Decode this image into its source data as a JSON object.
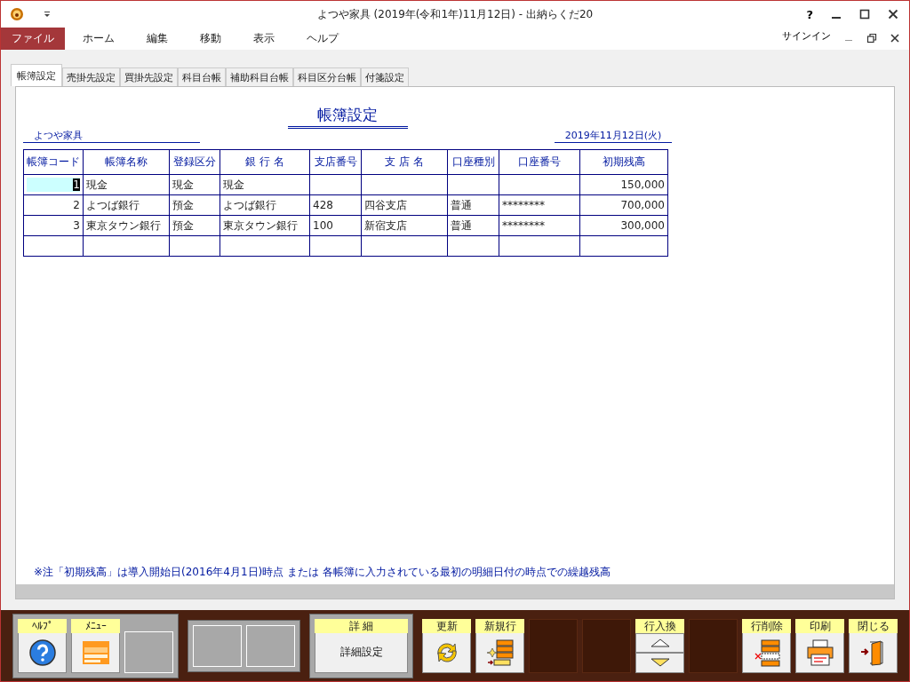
{
  "window": {
    "title": "よつや家具 (2019年(令和1年)11月12日) - 出納らくだ20",
    "help": "?"
  },
  "menu": {
    "items": [
      {
        "label": "ファイル",
        "selected": true
      },
      {
        "label": "ホーム",
        "selected": false
      },
      {
        "label": "編集",
        "selected": false
      },
      {
        "label": "移動",
        "selected": false
      },
      {
        "label": "表示",
        "selected": false
      },
      {
        "label": "ヘルプ",
        "selected": false
      }
    ],
    "sign_in": "サインイン"
  },
  "tabs": [
    {
      "label": "帳簿設定",
      "selected": true
    },
    {
      "label": "売掛先設定",
      "selected": false
    },
    {
      "label": "買掛先設定",
      "selected": false
    },
    {
      "label": "科目台帳",
      "selected": false
    },
    {
      "label": "補助科目台帳",
      "selected": false
    },
    {
      "label": "科目区分台帳",
      "selected": false
    },
    {
      "label": "付箋設定",
      "selected": false
    }
  ],
  "form": {
    "title": "帳簿設定",
    "company": "よつや家具",
    "date": "2019年11月12日(火)",
    "columns": [
      "帳簿コード",
      "帳簿名称",
      "登録区分",
      "銀 行 名",
      "支店番号",
      "支 店 名",
      "口座種別",
      "口座番号",
      "初期残高"
    ],
    "rows": [
      {
        "selected": true,
        "cells": [
          "1",
          "現金",
          "現金",
          "現金",
          null,
          null,
          null,
          null,
          "150,000"
        ]
      },
      {
        "selected": false,
        "cells": [
          "2",
          "よつば銀行",
          "預金",
          "よつば銀行",
          "428",
          "四谷支店",
          "普通",
          "********",
          "700,000"
        ]
      },
      {
        "selected": false,
        "cells": [
          "3",
          "東京タウン銀行",
          "預金",
          "東京タウン銀行",
          "100",
          "新宿支店",
          "普通",
          "********",
          "300,000"
        ]
      }
    ],
    "note": "※注「初期残高」は導入開始日(2016年4月1日)時点 または 各帳簿に入力されている最初の明細日付の時点での繰越残高"
  },
  "toolbar": [
    {
      "panel": true,
      "slots": [
        {
          "kind": "help",
          "label": "ﾍﾙﾌﾟ"
        },
        {
          "kind": "menu",
          "label": "ﾒﾆｭｰ"
        },
        {
          "kind": "empty"
        }
      ]
    },
    {
      "panel": true,
      "slots": [
        {
          "kind": "empty"
        },
        {
          "kind": "empty"
        }
      ]
    },
    {
      "panel": true,
      "slots": [
        {
          "kind": "text",
          "label": "詳 細",
          "text": "詳細設定"
        }
      ]
    },
    {
      "panel": false,
      "slots": [
        {
          "kind": "refresh",
          "label": "更新"
        },
        {
          "kind": "new-row",
          "label": "新規行"
        },
        {
          "kind": "empty"
        },
        {
          "kind": "empty"
        },
        {
          "kind": "updown",
          "label": "行入換"
        },
        {
          "kind": "empty"
        },
        {
          "kind": "delete-row",
          "label": "行削除"
        },
        {
          "kind": "print",
          "label": "印刷"
        },
        {
          "kind": "close",
          "label": "閉じる"
        }
      ]
    }
  ]
}
